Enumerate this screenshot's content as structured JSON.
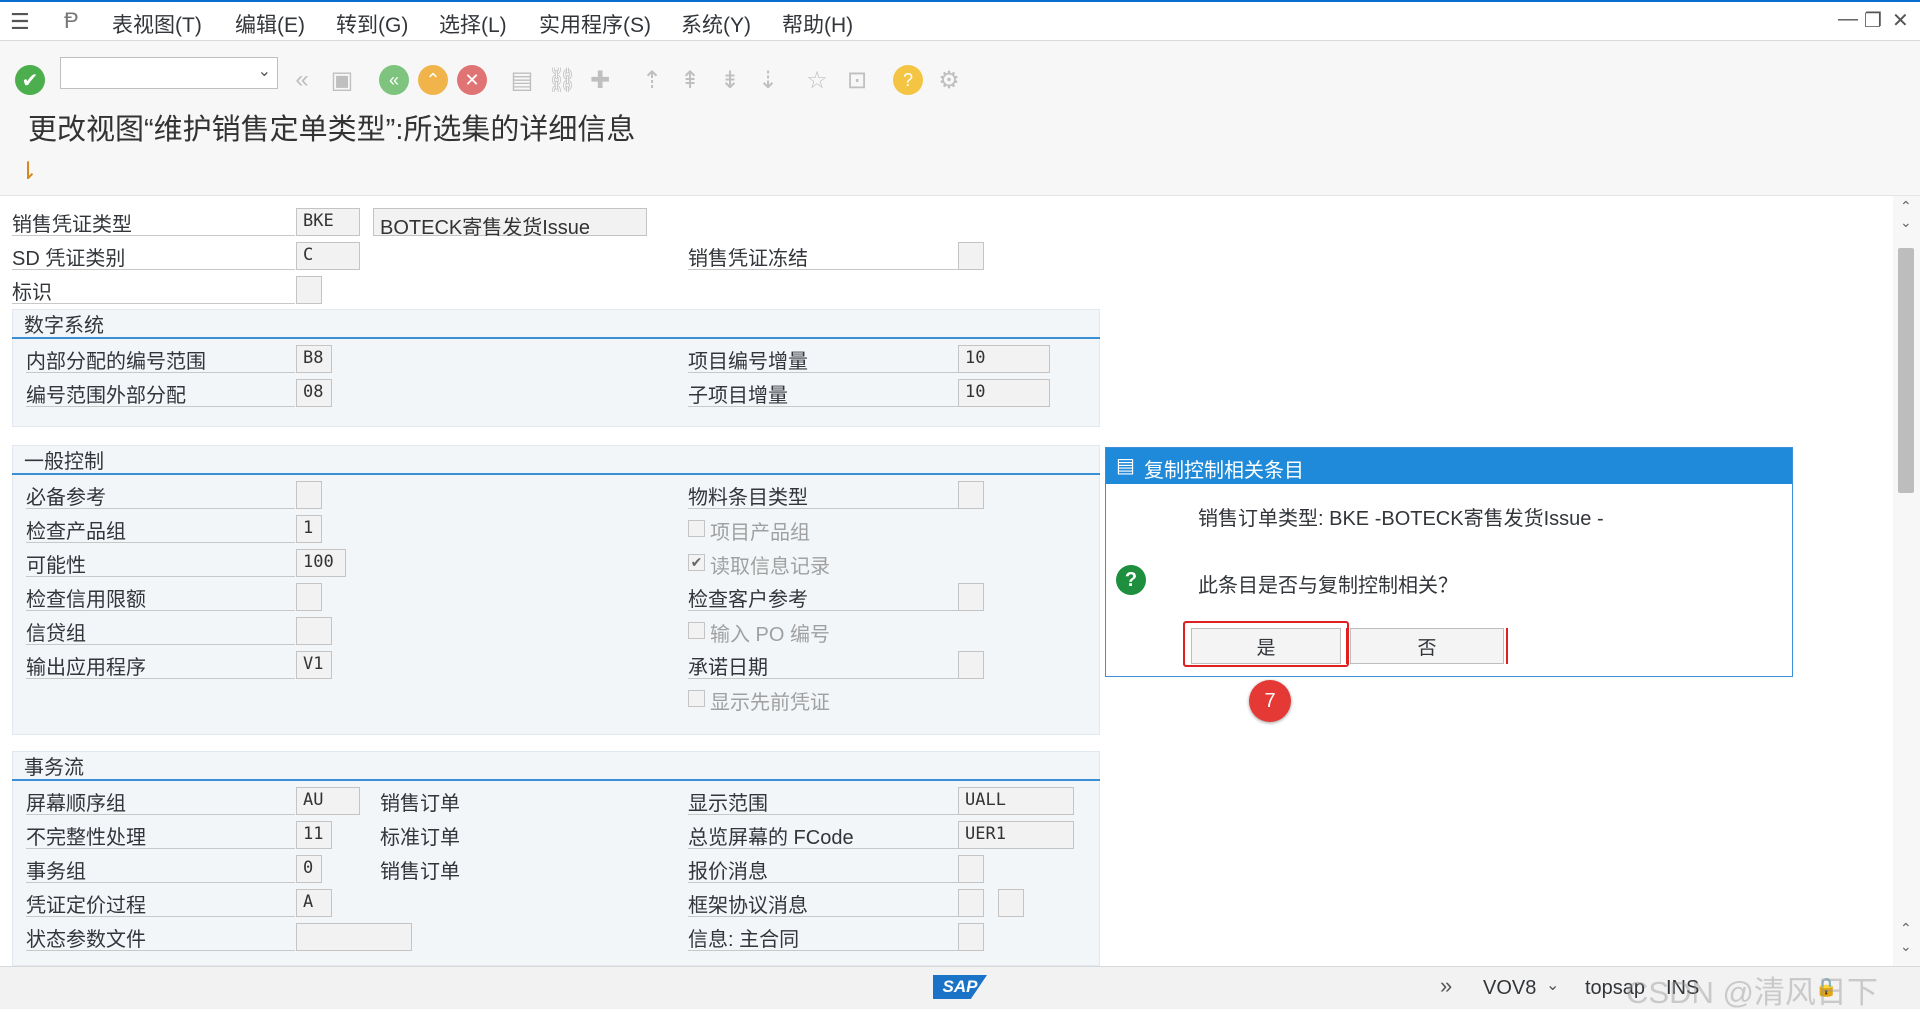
{
  "menu": [
    "表视图(T)",
    "编辑(E)",
    "转到(G)",
    "选择(L)",
    "实用程序(S)",
    "系统(Y)",
    "帮助(H)"
  ],
  "page_title": "更改视图“维护销售定单类型”:所选集的详细信息",
  "header": {
    "doc_type_label": "销售凭证类型",
    "doc_type_value": "BKE",
    "doc_type_desc": "BOTECK寄售发货Issue",
    "sd_cat_label": "SD 凭证类别",
    "sd_cat_value": "C",
    "freeze_label": "销售凭证冻结",
    "indicator_label": "标识"
  },
  "number_system": {
    "title": "数字系统",
    "internal_label": "内部分配的编号范围",
    "internal_value": "B8",
    "external_label": "编号范围外部分配",
    "external_value": "08",
    "item_incr_label": "项目编号增量",
    "item_incr_value": "10",
    "subitem_incr_label": "子项目增量",
    "subitem_incr_value": "10"
  },
  "general_control": {
    "title": "一般控制",
    "ref_mandatory_label": "必备参考",
    "check_div_label": "检查产品组",
    "check_div_value": "1",
    "probability_label": "可能性",
    "probability_value": "100",
    "check_credit_label": "检查信用限额",
    "credit_group_label": "信贷组",
    "output_app_label": "输出应用程序",
    "output_app_value": "V1",
    "material_item_label": "物料条目类型",
    "item_div_label": "项目产品组",
    "read_info_label": "读取信息记录",
    "check_cust_label": "检查客户参考",
    "enter_po_label": "输入 PO 编号",
    "commit_date_label": "承诺日期",
    "show_prev_label": "显示先前凭证"
  },
  "transaction_flow": {
    "title": "事务流",
    "screen_seq_label": "屏幕顺序组",
    "screen_seq_value": "AU",
    "screen_seq_desc": "销售订单",
    "incomp_label": "不完整性处理",
    "incomp_value": "11",
    "incomp_desc": "标准订单",
    "trans_group_label": "事务组",
    "trans_group_value": "0",
    "trans_group_desc": "销售订单",
    "pricing_label": "凭证定价过程",
    "pricing_value": "A",
    "status_profile_label": "状态参数文件",
    "display_range_label": "显示范围",
    "display_range_value": "UALL",
    "fcode_label": "总览屏幕的 FCode",
    "fcode_value": "UER1",
    "quote_msg_label": "报价消息",
    "outline_msg_label": "框架协议消息",
    "info_master_label": "信息: 主合同"
  },
  "dialog": {
    "title": "复制控制相关条目",
    "line1": "销售订单类型: BKE -BOTECK寄售发货Issue -",
    "question": "此条目是否与复制控制相关？",
    "yes": "是",
    "no": "否",
    "step": "7"
  },
  "status": {
    "transaction": "VOV8",
    "server": "topsap",
    "mode": "INS",
    "sap": "SAP",
    "watermark": "CSDN @清风日下"
  },
  "colors": {
    "accent": "#1f8ad9",
    "highlight_red": "#e02020"
  }
}
